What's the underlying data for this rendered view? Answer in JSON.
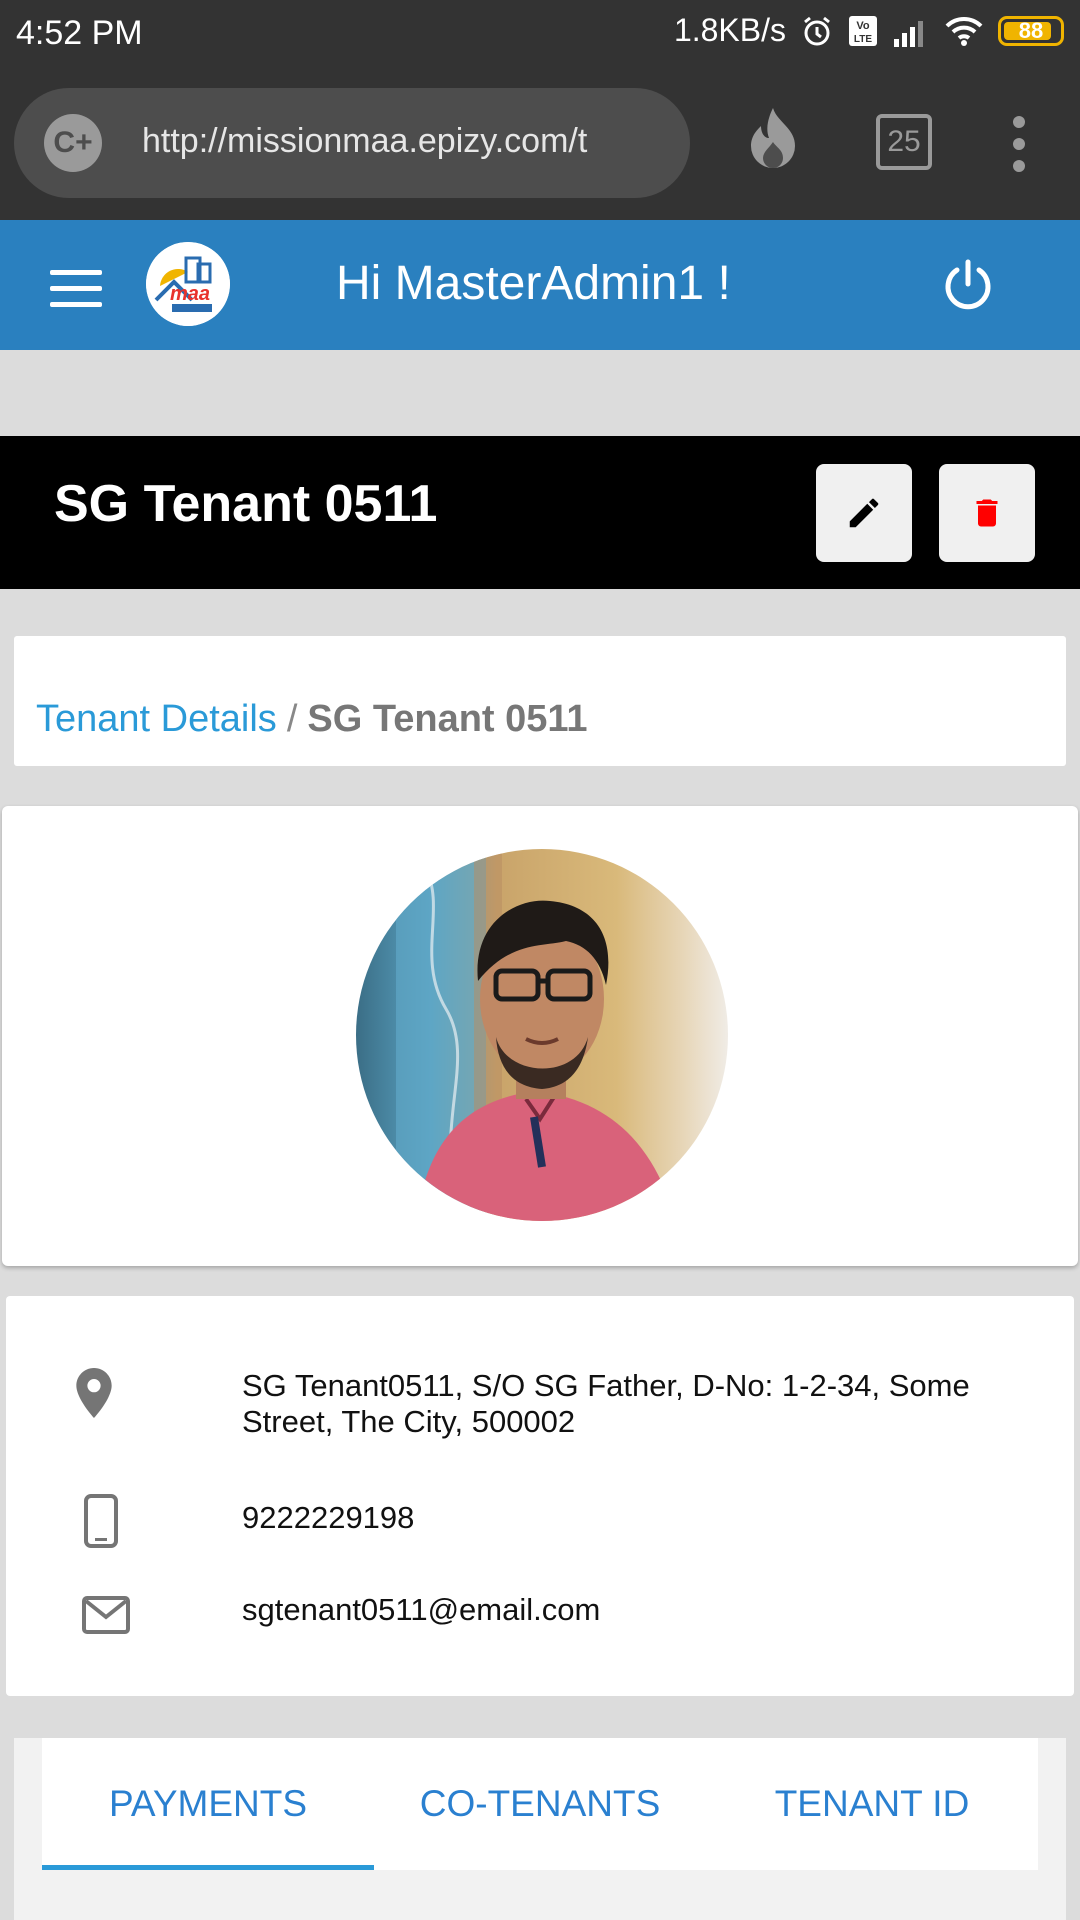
{
  "status_bar": {
    "time": "4:52 PM",
    "speed": "1.8KB/s",
    "battery": "88",
    "battery_level": 0.88,
    "icons": [
      "alarm-icon",
      "volte-icon",
      "signal-icon",
      "wifi-icon",
      "battery-icon"
    ]
  },
  "browser": {
    "site_badge": "C+",
    "url": "http://missionmaa.epizy.com/t",
    "tab_count": "25",
    "icons": [
      "flame-icon",
      "tabs-icon",
      "menu-dots-icon"
    ]
  },
  "header": {
    "greeting": "Hi MasterAdmin1 !",
    "logo_alt": "maa PROPERTIES",
    "brand_color": "#2a80bf",
    "icons": [
      "hamburger-icon",
      "logo",
      "power-icon"
    ]
  },
  "tenant": {
    "title": "SG Tenant 0511",
    "edit_icon": "pencil-icon",
    "delete_icon": "trash-icon",
    "delete_color": "#ff0000"
  },
  "breadcrumb": {
    "parent": "Tenant Details",
    "separator": "/",
    "current": "SG Tenant 0511"
  },
  "contact": {
    "address": "SG Tenant0511, S/O SG Father, D-No: 1-2-34, Some Street, The City, 500002",
    "phone": "9222229198",
    "email": "sgtenant0511@email.com"
  },
  "tabs": {
    "items": [
      "PAYMENTS",
      "CO-TENANTS",
      "TENANT ID"
    ],
    "active": "PAYMENTS"
  }
}
